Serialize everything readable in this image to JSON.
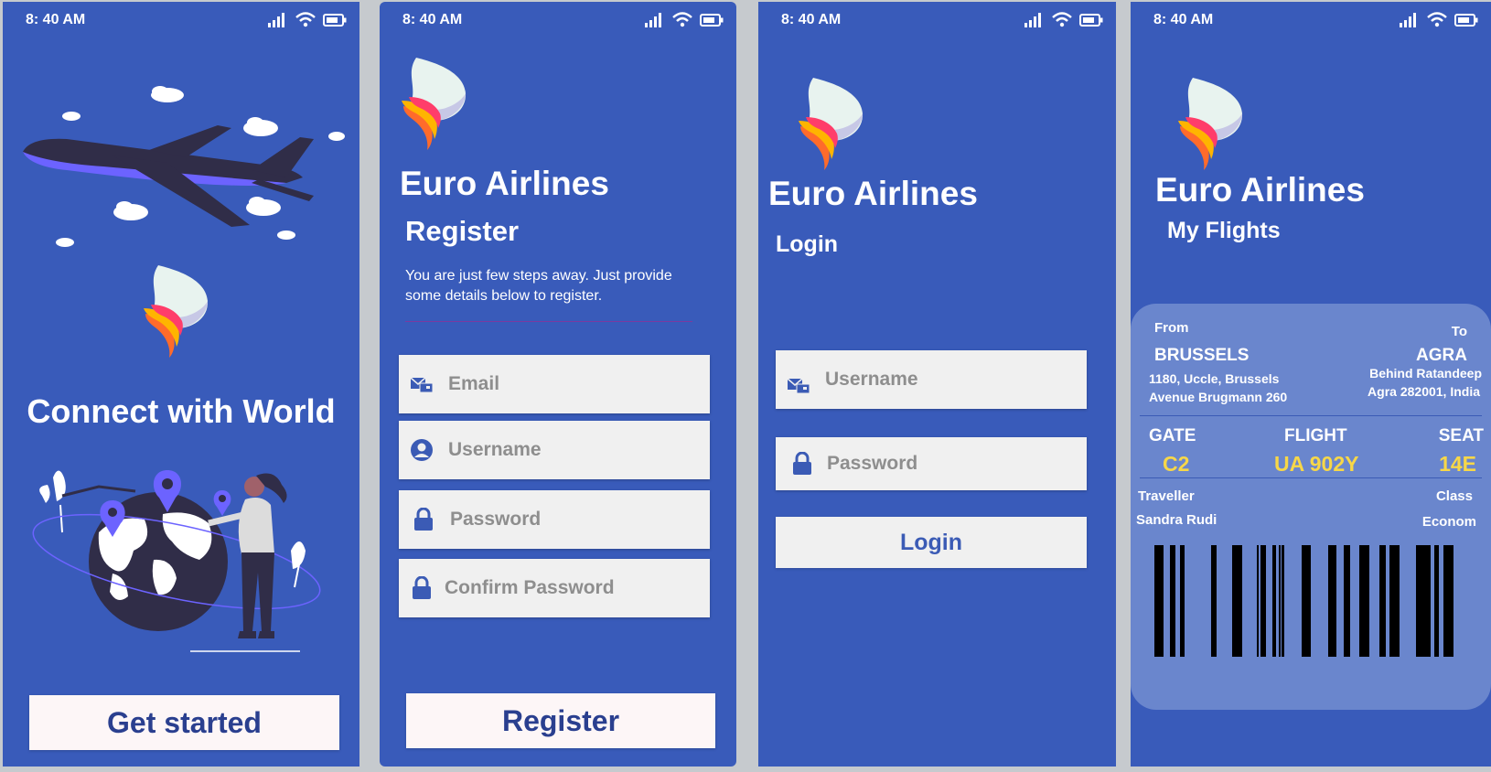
{
  "status_bar": {
    "time": "8: 40 AM"
  },
  "welcome": {
    "headline": "Connect with World",
    "cta_label": "Get started"
  },
  "register": {
    "brand": "Euro Airlines",
    "title": "Register",
    "description": "You are just few steps away. Just provide some details below to register.",
    "email_placeholder": "Email",
    "username_placeholder": "Username",
    "password_placeholder": "Password",
    "confirm_placeholder": "Confirm Password",
    "submit_label": "Register"
  },
  "login": {
    "brand": "Euro Airlines",
    "title": "Login",
    "username_placeholder": "Username",
    "password_placeholder": "Password",
    "submit_label": "Login"
  },
  "flights": {
    "brand": "Euro Airlines",
    "title": "My Flights",
    "ticket": {
      "from_label": "From",
      "to_label": "To",
      "from_city": "BRUSSELS",
      "from_addr1": "1180, Uccle, Brussels",
      "from_addr2": "Avenue Brugmann 260",
      "to_city": "AGRA",
      "to_addr1": "Behind Ratandeep",
      "to_addr2": "Agra 282001, India",
      "gate_label": "GATE",
      "gate": "C2",
      "flight_label": "FLIGHT",
      "flight": "UA 902Y",
      "seat_label": "SEAT",
      "seat": "14E",
      "traveller_label": "Traveller",
      "traveller": "Sandra Rudi",
      "class_label": "Class",
      "class_value": "Econom"
    }
  },
  "colors": {
    "background": "#395bba",
    "ticket": "#6a86cd",
    "highlight": "#f7d748",
    "button_text": "#2a3f8f"
  }
}
